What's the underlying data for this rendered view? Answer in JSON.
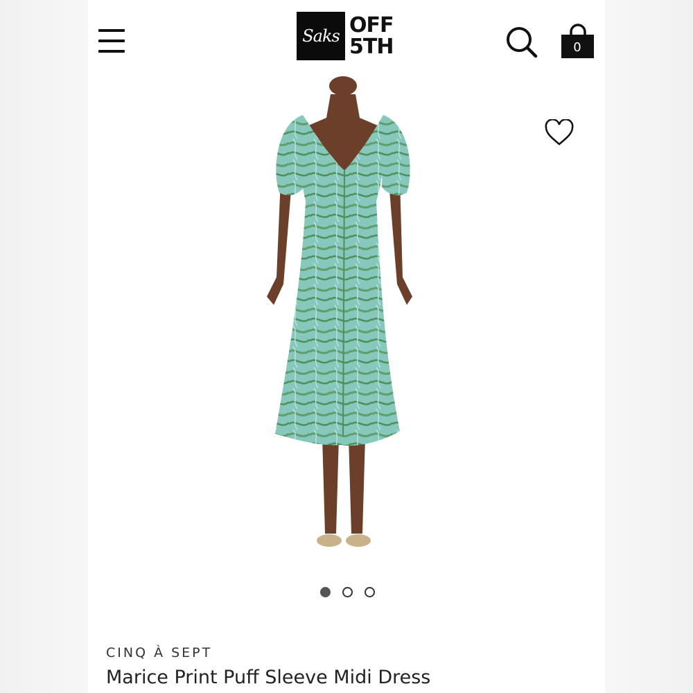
{
  "header": {
    "menu_icon": "hamburger-menu-icon",
    "logo_script": "Saks",
    "logo_line1": "OFF",
    "logo_line2": "5TH",
    "search_icon": "search-icon",
    "bag_icon": "shopping-bag-icon",
    "bag_count": "0"
  },
  "product": {
    "wishlist_icon": "heart-icon",
    "carousel": {
      "count": 3,
      "active_index": 0
    },
    "brand": "CINQ À SEPT",
    "name": "Marice Print Puff Sleeve Midi Dress"
  },
  "colors": {
    "dress_primary": "#7fc3b8",
    "dress_secondary": "#5f9e6a",
    "skin": "#6b3f2a",
    "logo_bg": "#0b0b0b"
  }
}
